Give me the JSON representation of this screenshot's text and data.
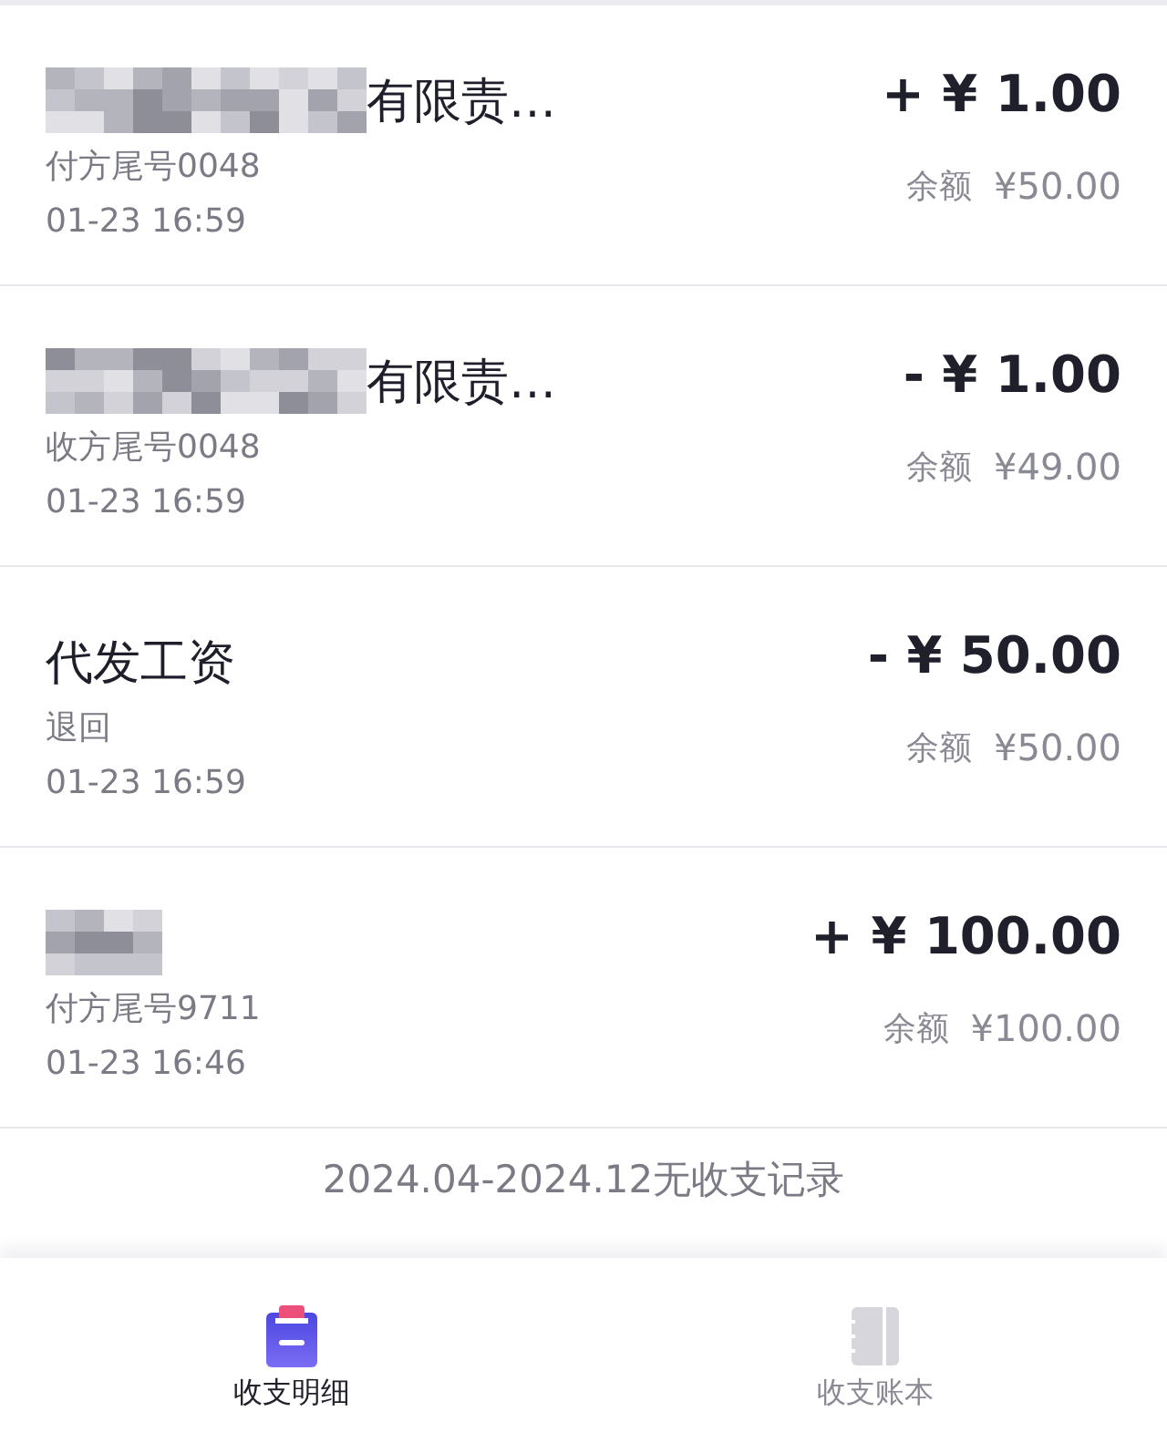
{
  "transactions": [
    {
      "redacted": true,
      "title": "有限责…",
      "counterparty": "付方尾号0048",
      "time": "01-23 16:59",
      "amount": "+ ¥ 1.00",
      "balance_label": "余额",
      "balance": "¥50.00"
    },
    {
      "redacted": true,
      "title": "有限责…",
      "counterparty": "收方尾号0048",
      "time": "01-23 16:59",
      "amount": "- ¥ 1.00",
      "balance_label": "余额",
      "balance": "¥49.00"
    },
    {
      "redacted": false,
      "title": "代发工资",
      "counterparty": "退回",
      "time": "01-23 16:59",
      "amount": "- ¥ 50.00",
      "balance_label": "余额",
      "balance": "¥50.00"
    },
    {
      "redacted": true,
      "counterparty": "付方尾号9711",
      "time": "01-23 16:46",
      "amount": "+ ¥ 100.00",
      "balance_label": "余额",
      "balance": "¥100.00"
    }
  ],
  "footer_note": "2024.04-2024.12无收支记录",
  "tabs": [
    {
      "label": "收支明细",
      "kind": "clipboard",
      "selected": true
    },
    {
      "label": "收支账本",
      "kind": "book",
      "selected": false
    }
  ]
}
